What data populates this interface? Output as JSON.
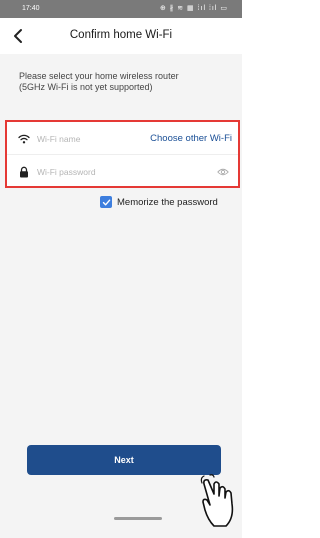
{
  "status_bar": {
    "time": "17:40",
    "icons_text": "⊕ ∦ ≋ ▦ ⁞ıl ⁞ıl ▭"
  },
  "header": {
    "title": "Confirm home Wi-Fi"
  },
  "instructions": "Please select your home wireless router(5GHz Wi-Fi is not yet supported)",
  "wifi_form": {
    "ssid_placeholder": "Wi-Fi name",
    "choose_other_label": "Choose other Wi-Fi",
    "password_placeholder": "Wi-Fi password"
  },
  "memorize": {
    "label": "Memorize the password",
    "checked": true
  },
  "next_label": "Next",
  "colors": {
    "accent": "#1f4d8c",
    "link": "#1a4f96",
    "highlight_border": "#e53935",
    "checkbox": "#3d7ede"
  }
}
